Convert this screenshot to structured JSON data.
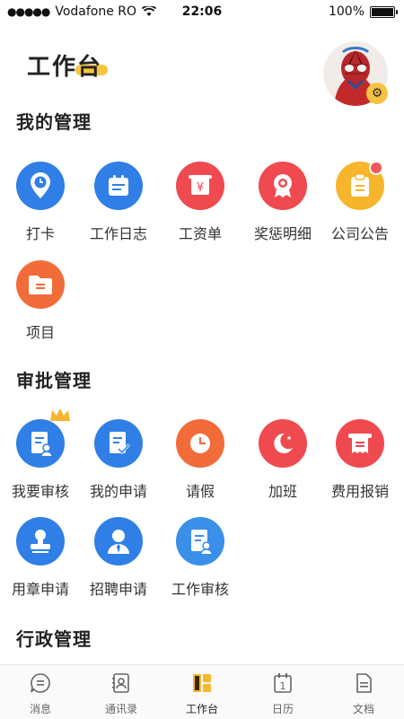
{
  "status_bar": {
    "carrier": "Vodafone RO",
    "time": "22:06",
    "battery": "100%",
    "battery_level": 1.0
  },
  "header": {
    "title": "工作台"
  },
  "sections": [
    {
      "title": "我的管理",
      "items": [
        {
          "label": "打卡",
          "icon": "location-pin-icon",
          "color": "#2f7fe6"
        },
        {
          "label": "工作日志",
          "icon": "calendar-icon",
          "color": "#2f7fe6"
        },
        {
          "label": "工资单",
          "icon": "yen-receipt-icon",
          "color": "#ee4a4f"
        },
        {
          "label": "奖惩明细",
          "icon": "medal-icon",
          "color": "#ee4a4f"
        },
        {
          "label": "公司公告",
          "icon": "clipboard-icon",
          "color": "#f7b52c"
        },
        {
          "label": "项目",
          "icon": "folder-icon",
          "color": "#f26c3a"
        }
      ]
    },
    {
      "title": "审批管理",
      "items": [
        {
          "label": "我要审核",
          "icon": "document-user-icon",
          "color": "#2f7fe6"
        },
        {
          "label": "我的申请",
          "icon": "document-check-icon",
          "color": "#2f7fe6"
        },
        {
          "label": "请假",
          "icon": "clock-icon",
          "color": "#f26c3a"
        },
        {
          "label": "加班",
          "icon": "moon-icon",
          "color": "#ee4a4f"
        },
        {
          "label": "费用报销",
          "icon": "receipt-icon",
          "color": "#ee4a4f"
        },
        {
          "label": "用章申请",
          "icon": "stamp-icon",
          "color": "#2f7fe6"
        },
        {
          "label": "招聘申请",
          "icon": "person-tie-icon",
          "color": "#2f7fe6"
        },
        {
          "label": "工作审核",
          "icon": "document-user-icon",
          "color": "#3a8fe8"
        }
      ]
    },
    {
      "title": "行政管理"
    }
  ],
  "tab_bar": [
    {
      "label": "消息",
      "icon": "message-icon"
    },
    {
      "label": "通讯录",
      "icon": "contacts-icon"
    },
    {
      "label": "工作台",
      "icon": "workbench-icon",
      "active": true,
      "color": "#f6b82f"
    },
    {
      "label": "日历",
      "icon": "calendar-day-icon",
      "day": "1"
    },
    {
      "label": "文档",
      "icon": "document-icon"
    }
  ]
}
